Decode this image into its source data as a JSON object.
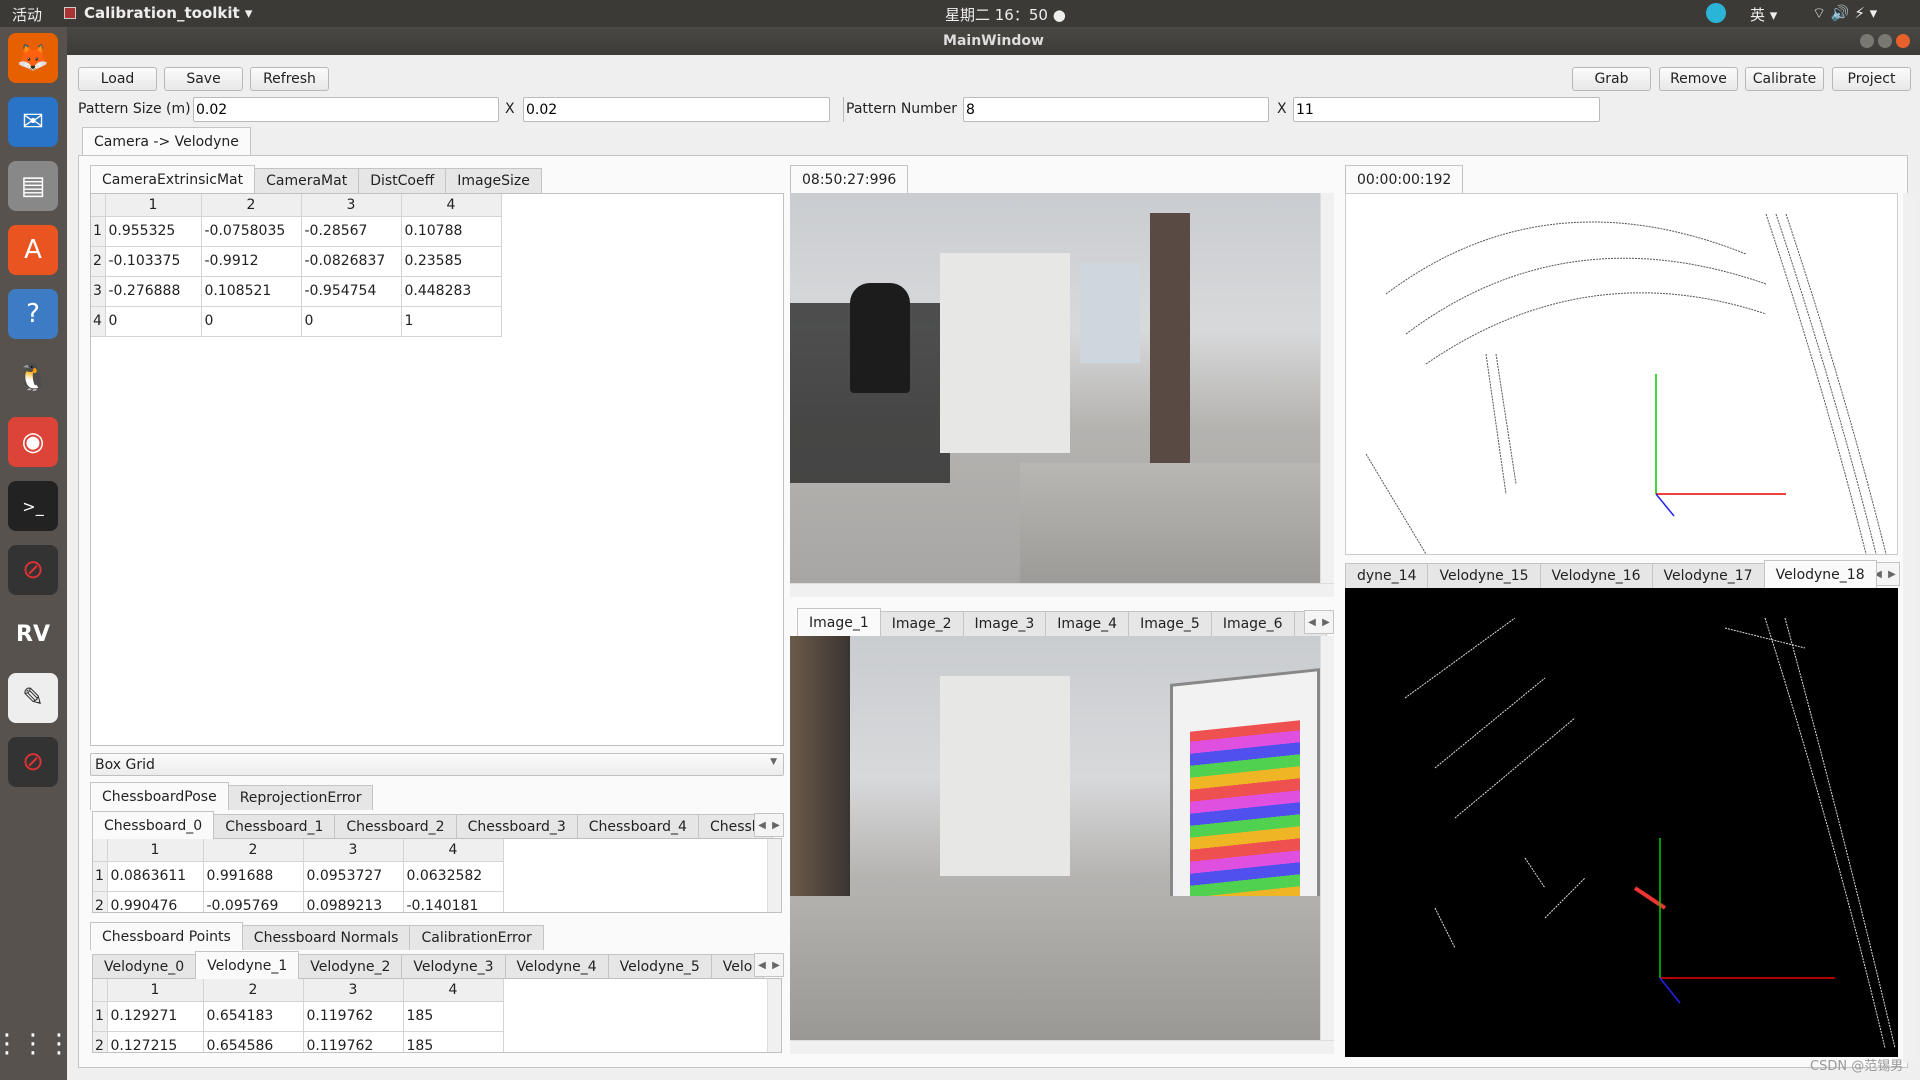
{
  "topbar": {
    "activities": "活动",
    "app": "Calibration_toolkit ▾",
    "clock": "星期二 16：50 ●",
    "ime": "英 ▾",
    "status": "⌔ 🔊 ⚡ ▾"
  },
  "dock": {
    "items": [
      "firefox-icon",
      "thunderbird-icon",
      "files-icon",
      "software-icon",
      "help-icon",
      "qq-icon",
      "chrome-icon",
      "terminal-icon",
      "app-icon",
      "rviz-icon",
      "text-editor-icon",
      "app-icon"
    ]
  },
  "window": {
    "title": "MainWindow"
  },
  "toolbar": {
    "load": "Load",
    "save": "Save",
    "refresh": "Refresh",
    "grab": "Grab",
    "remove": "Remove",
    "calibrate": "Calibrate",
    "project": "Project"
  },
  "pattern": {
    "size_label": "Pattern Size (m)",
    "size_x": "0.02",
    "size_y": "0.02",
    "x_label": "X",
    "number_label": "Pattern Number",
    "num_x": "8",
    "num_y": "11"
  },
  "main_tab": "Camera -> Velodyne",
  "calib_tabs": [
    "CameraExtrinsicMat",
    "CameraMat",
    "DistCoeff",
    "ImageSize"
  ],
  "extrinsic": {
    "headers": [
      "1",
      "2",
      "3",
      "4"
    ],
    "rows": [
      [
        "0.955325",
        "-0.0758035",
        "-0.28567",
        "0.10788"
      ],
      [
        "-0.103375",
        "-0.9912",
        "-0.0826837",
        "0.23585"
      ],
      [
        "-0.276888",
        "0.108521",
        "-0.954754",
        "0.448283"
      ],
      [
        "0",
        "0",
        "0",
        "1"
      ]
    ]
  },
  "combo": {
    "value": "Box Grid"
  },
  "pose_tabs": [
    "ChessboardPose",
    "ReprojectionError"
  ],
  "chessboard_tabs": [
    "Chessboard_0",
    "Chessboard_1",
    "Chessboard_2",
    "Chessboard_3",
    "Chessboard_4",
    "Chessb"
  ],
  "pose_table": {
    "headers": [
      "1",
      "2",
      "3",
      "4"
    ],
    "rows": [
      [
        "0.0863611",
        "0.991688",
        "0.0953727",
        "0.0632582"
      ],
      [
        "0.990476",
        "-0.095769",
        "0.0989213",
        "-0.140181"
      ]
    ]
  },
  "points_tabs": [
    "Chessboard Points",
    "Chessboard Normals",
    "CalibrationError"
  ],
  "velodyne_tabs_left": [
    "Velodyne_0",
    "Velodyne_1",
    "Velodyne_2",
    "Velodyne_3",
    "Velodyne_4",
    "Velodyne_5",
    "Velo"
  ],
  "points_table": {
    "headers": [
      "1",
      "2",
      "3",
      "4"
    ],
    "rows": [
      [
        "0.129271",
        "0.654183",
        "0.119762",
        "185"
      ],
      [
        "0.127215",
        "0.654586",
        "0.119762",
        "185"
      ]
    ]
  },
  "camera_timestamp": "08:50:27:996",
  "image_tabs": [
    "Image_1",
    "Image_2",
    "Image_3",
    "Image_4",
    "Image_5",
    "Image_6",
    "Ir"
  ],
  "lidar_timestamp": "00:00:00:192",
  "velodyne_tabs_right": [
    "dyne_14",
    "Velodyne_15",
    "Velodyne_16",
    "Velodyne_17",
    "Velodyne_18"
  ],
  "watermark": "CSDN @范锡男"
}
